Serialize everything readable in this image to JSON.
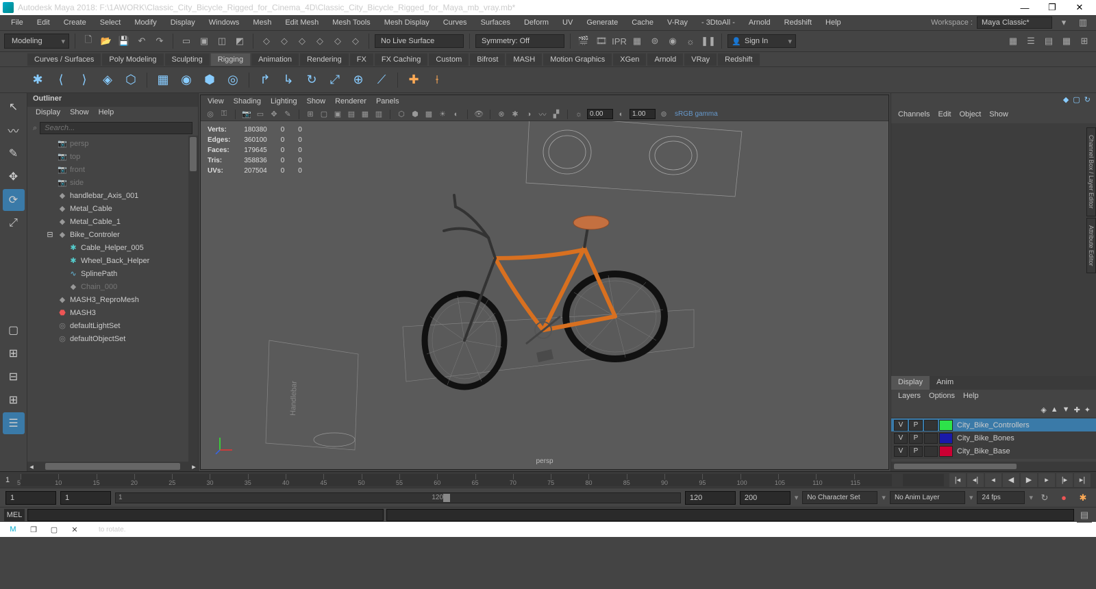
{
  "title": "Autodesk Maya 2018: F:\\1AWORK\\Classic_City_Bicycle_Rigged_for_Cinema_4D\\Classic_City_Bicycle_Rigged_for_Maya_mb_vray.mb*",
  "menubar": [
    "File",
    "Edit",
    "Create",
    "Select",
    "Modify",
    "Display",
    "Windows",
    "Mesh",
    "Edit Mesh",
    "Mesh Tools",
    "Mesh Display",
    "Curves",
    "Surfaces",
    "Deform",
    "UV",
    "Generate",
    "Cache",
    "V-Ray",
    "- 3DtoAll -",
    "Arnold",
    "Redshift",
    "Help"
  ],
  "workspace": {
    "label": "Workspace :",
    "value": "Maya Classic*"
  },
  "mode": "Modeling",
  "snap_surface": "No Live Surface",
  "symmetry": "Symmetry: Off",
  "signin": "Sign In",
  "shelf_tabs": [
    "Curves / Surfaces",
    "Poly Modeling",
    "Sculpting",
    "Rigging",
    "Animation",
    "Rendering",
    "FX",
    "FX Caching",
    "Custom",
    "Bifrost",
    "MASH",
    "Motion Graphics",
    "XGen",
    "Arnold",
    "VRay",
    "Redshift"
  ],
  "shelf_active": 3,
  "outliner": {
    "title": "Outliner",
    "menu": [
      "Display",
      "Show",
      "Help"
    ],
    "search_ph": "Search...",
    "items": [
      {
        "icon": "cam",
        "label": "persp",
        "dim": true,
        "indent": 0
      },
      {
        "icon": "cam",
        "label": "top",
        "dim": true,
        "indent": 0
      },
      {
        "icon": "cam",
        "label": "front",
        "dim": true,
        "indent": 0
      },
      {
        "icon": "cam",
        "label": "side",
        "dim": true,
        "indent": 0
      },
      {
        "icon": "transform",
        "label": "handlebar_Axis_001",
        "indent": 0
      },
      {
        "icon": "transform",
        "label": "Metal_Cable",
        "indent": 0
      },
      {
        "icon": "transform",
        "label": "Metal_Cable_1",
        "indent": 0
      },
      {
        "icon": "transform",
        "label": "Bike_Controler",
        "indent": 0,
        "expand": "-"
      },
      {
        "icon": "joint",
        "label": "Cable_Helper_005",
        "indent": 1
      },
      {
        "icon": "joint",
        "label": "Wheel_Back_Helper",
        "indent": 1
      },
      {
        "icon": "curve",
        "label": "SplinePath",
        "indent": 1
      },
      {
        "icon": "transform",
        "label": "Chain_000",
        "dim": true,
        "indent": 1
      },
      {
        "icon": "transform",
        "label": "MASH3_ReproMesh",
        "indent": 0
      },
      {
        "icon": "mash",
        "label": "MASH3",
        "indent": 0
      },
      {
        "icon": "set",
        "label": "defaultLightSet",
        "indent": 0
      },
      {
        "icon": "set",
        "label": "defaultObjectSet",
        "indent": 0
      }
    ]
  },
  "viewport": {
    "menu": [
      "View",
      "Shading",
      "Lighting",
      "Show",
      "Renderer",
      "Panels"
    ],
    "time_a": "0.00",
    "time_b": "1.00",
    "gamma": "sRGB gamma",
    "hud": [
      [
        "Verts:",
        "180380",
        "0",
        "0"
      ],
      [
        "Edges:",
        "360100",
        "0",
        "0"
      ],
      [
        "Faces:",
        "179645",
        "0",
        "0"
      ],
      [
        "Tris:",
        "358836",
        "0",
        "0"
      ],
      [
        "UVs:",
        "207504",
        "0",
        "0"
      ]
    ],
    "camera": "persp",
    "plane_label": "Handlebar"
  },
  "channelbox": {
    "menu": [
      "Channels",
      "Edit",
      "Object",
      "Show"
    ],
    "tabs": [
      "Display",
      "Anim"
    ],
    "menu2": [
      "Layers",
      "Options",
      "Help"
    ],
    "layers": [
      {
        "v": "V",
        "p": "P",
        "color": "#2de24a",
        "name": "City_Bike_Controllers",
        "sel": true
      },
      {
        "v": "V",
        "p": "P",
        "color": "#1a1aaa",
        "name": "City_Bike_Bones"
      },
      {
        "v": "V",
        "p": "P",
        "color": "#cc0033",
        "name": "City_Bike_Base"
      }
    ]
  },
  "side_tabs": [
    "Channel Box / Layer Editor",
    "Attribute Editor"
  ],
  "timeline": {
    "start": "1",
    "ticks": [
      5,
      10,
      15,
      20,
      25,
      30,
      35,
      40,
      45,
      50,
      55,
      60,
      65,
      70,
      75,
      80,
      85,
      90,
      95,
      100,
      105,
      110,
      115
    ],
    "end": "120"
  },
  "range": {
    "start": "1",
    "play_start": "1",
    "slider_start": "1",
    "slider_end": "120",
    "play_end": "120",
    "end": "200",
    "charset": "No Character Set",
    "animlayer": "No Anim Layer",
    "fps": "24 fps"
  },
  "cmd": {
    "label": "MEL"
  },
  "statusbar_tip": "to rotate."
}
